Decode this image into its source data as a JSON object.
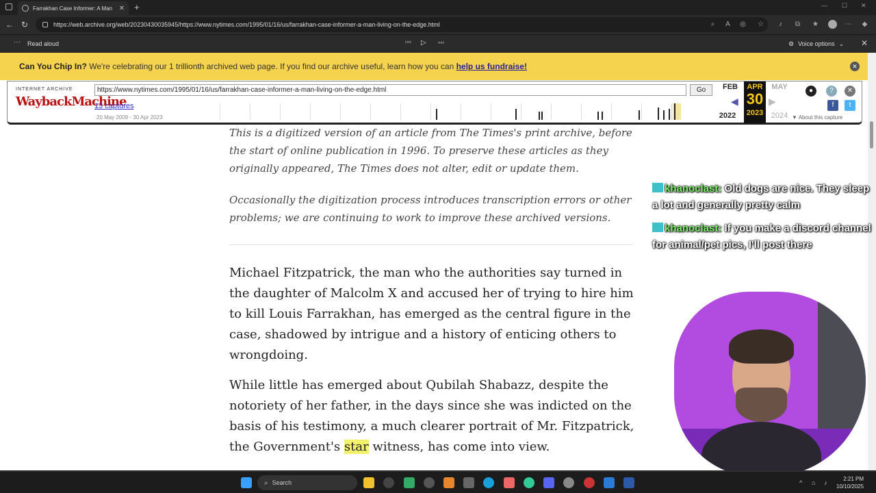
{
  "browser": {
    "tab_title": "Farrakhan Case Informer: A Man",
    "url": "https://web.archive.org/web/20230430035945/https://www.nytimes.com/1995/01/16/us/farrakhan-case-informer-a-man-living-on-the-edge.html"
  },
  "read_aloud": {
    "label": "Read aloud",
    "voice_options": "Voice options"
  },
  "banner": {
    "lead": "Can You Chip In?",
    "text": " We're celebrating our 1 trillionth archived web page. If you find our archive useful, learn how you can ",
    "link": "help us fundraise!"
  },
  "wayback": {
    "logo_top": "INTERNET ARCHIVE",
    "logo": "WaybackMachine",
    "url": "https://www.nytimes.com/1995/01/16/us/farrakhan-case-informer-a-man-living-on-the-edge.html",
    "go": "Go",
    "captures": "13 captures",
    "range": "20 May 2009 - 30 Apr 2023",
    "prev_month": "FEB",
    "prev_year": "2022",
    "cur_month": "APR",
    "cur_day": "30",
    "cur_year": "2023",
    "next_month": "MAY",
    "next_year": "2024",
    "about": "About this capture"
  },
  "article": {
    "note1": "This is a digitized version of an article from The Times's print archive, before the start of online publication in 1996. To preserve these articles as they originally appeared, The Times does not alter, edit or update them.",
    "note2": "Occasionally the digitization process introduces transcription errors or other problems; we are continuing to work to improve these archived versions.",
    "para1": "Michael Fitzpatrick, the man who the authorities say turned in the daughter of Malcolm X and accused her of trying to hire him to kill Louis Farrakhan, has emerged as the central figure in the case, shadowed by intrigue and a history of enticing others to wrongdoing.",
    "para2_a": "While little has emerged about Qubilah Shabazz, despite the notoriety of her father, in the days since she was indicted on the basis of his testimony, a much clearer portrait of Mr. Fitzpatrick, the Government's ",
    "para2_hl": "star",
    "para2_b": " witness, has come into view."
  },
  "chat": [
    {
      "user": "khanoclast:",
      "text": " Old dogs are nice. They sleep a lot and generally pretty calm"
    },
    {
      "user": "khanoclast:",
      "text": " If you make a discord channel for animal/pet pics, I'll post there"
    }
  ],
  "taskbar": {
    "search": "Search",
    "time": "2:21 PM",
    "date": "10/10/2025"
  },
  "colors": {
    "banner": "#f6d34e",
    "wayback_red": "#b11111",
    "chat_user": "#7cf26b",
    "cam_bg": "#b24be0"
  }
}
